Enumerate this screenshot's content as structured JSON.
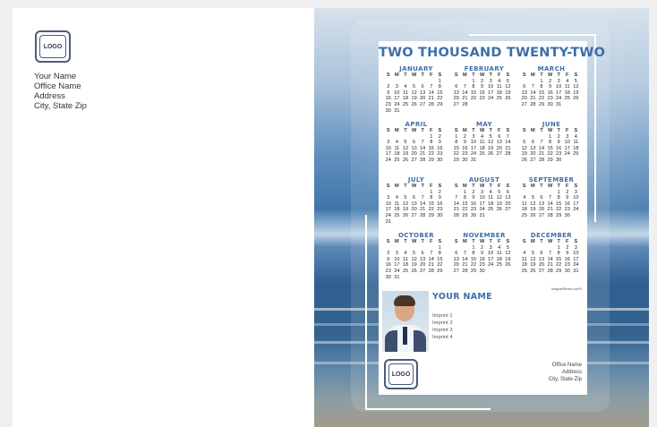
{
  "sender": {
    "logo": "LOGO",
    "lines": [
      "Your Name",
      "Office Name",
      "Address",
      "City, State Zip"
    ]
  },
  "card": {
    "title": "TWO THOUSAND TWENTY-TWO",
    "dow": [
      "S",
      "M",
      "T",
      "W",
      "T",
      "F",
      "S"
    ],
    "months": [
      {
        "name": "JANUARY",
        "weeks": [
          [
            "",
            "",
            "",
            "",
            "",
            "",
            "1"
          ],
          [
            "2",
            "3",
            "4",
            "5",
            "6",
            "7",
            "8"
          ],
          [
            "9",
            "10",
            "11",
            "12",
            "13",
            "14",
            "15"
          ],
          [
            "16",
            "17",
            "18",
            "19",
            "20",
            "21",
            "22"
          ],
          [
            "23",
            "24",
            "25",
            "26",
            "27",
            "28",
            "29"
          ],
          [
            "30",
            "31",
            "",
            "",
            "",
            "",
            ""
          ]
        ]
      },
      {
        "name": "FEBRUARY",
        "weeks": [
          [
            "",
            "",
            "1",
            "2",
            "3",
            "4",
            "5"
          ],
          [
            "6",
            "7",
            "8",
            "9",
            "10",
            "11",
            "12"
          ],
          [
            "13",
            "14",
            "15",
            "16",
            "17",
            "18",
            "19"
          ],
          [
            "20",
            "21",
            "22",
            "23",
            "24",
            "25",
            "26"
          ],
          [
            "27",
            "28",
            "",
            "",
            "",
            "",
            ""
          ]
        ]
      },
      {
        "name": "MARCH",
        "weeks": [
          [
            "",
            "",
            "1",
            "2",
            "3",
            "4",
            "5"
          ],
          [
            "6",
            "7",
            "8",
            "9",
            "10",
            "11",
            "12"
          ],
          [
            "13",
            "14",
            "15",
            "16",
            "17",
            "18",
            "19"
          ],
          [
            "20",
            "21",
            "22",
            "23",
            "24",
            "25",
            "26"
          ],
          [
            "27",
            "28",
            "29",
            "30",
            "31",
            "",
            ""
          ]
        ]
      },
      {
        "name": "APRIL",
        "weeks": [
          [
            "",
            "",
            "",
            "",
            "",
            "1",
            "2"
          ],
          [
            "3",
            "4",
            "5",
            "6",
            "7",
            "8",
            "9"
          ],
          [
            "10",
            "11",
            "12",
            "13",
            "14",
            "15",
            "16"
          ],
          [
            "17",
            "18",
            "19",
            "20",
            "21",
            "22",
            "23"
          ],
          [
            "24",
            "25",
            "26",
            "27",
            "28",
            "29",
            "30"
          ]
        ]
      },
      {
        "name": "MAY",
        "weeks": [
          [
            "1",
            "2",
            "3",
            "4",
            "5",
            "6",
            "7"
          ],
          [
            "8",
            "9",
            "10",
            "11",
            "12",
            "13",
            "14"
          ],
          [
            "15",
            "16",
            "17",
            "18",
            "19",
            "20",
            "21"
          ],
          [
            "22",
            "23",
            "24",
            "25",
            "26",
            "27",
            "28"
          ],
          [
            "29",
            "30",
            "31",
            "",
            "",
            "",
            ""
          ]
        ]
      },
      {
        "name": "JUNE",
        "weeks": [
          [
            "",
            "",
            "",
            "1",
            "2",
            "3",
            "4"
          ],
          [
            "5",
            "6",
            "7",
            "8",
            "9",
            "10",
            "11"
          ],
          [
            "12",
            "13",
            "14",
            "15",
            "16",
            "17",
            "18"
          ],
          [
            "19",
            "20",
            "21",
            "22",
            "23",
            "24",
            "25"
          ],
          [
            "26",
            "27",
            "28",
            "29",
            "30",
            "",
            ""
          ]
        ]
      },
      {
        "name": "JULY",
        "weeks": [
          [
            "",
            "",
            "",
            "",
            "",
            "1",
            "2"
          ],
          [
            "3",
            "4",
            "5",
            "6",
            "7",
            "8",
            "9"
          ],
          [
            "10",
            "11",
            "12",
            "13",
            "14",
            "15",
            "16"
          ],
          [
            "17",
            "18",
            "19",
            "20",
            "21",
            "22",
            "23"
          ],
          [
            "24",
            "25",
            "26",
            "27",
            "28",
            "29",
            "30"
          ],
          [
            "31",
            "",
            "",
            "",
            "",
            "",
            ""
          ]
        ]
      },
      {
        "name": "AUGUST",
        "weeks": [
          [
            "",
            "1",
            "2",
            "3",
            "4",
            "5",
            "6"
          ],
          [
            "7",
            "8",
            "9",
            "10",
            "11",
            "12",
            "13"
          ],
          [
            "14",
            "15",
            "16",
            "17",
            "18",
            "19",
            "20"
          ],
          [
            "21",
            "22",
            "23",
            "24",
            "25",
            "26",
            "27"
          ],
          [
            "28",
            "29",
            "30",
            "31",
            "",
            "",
            ""
          ]
        ]
      },
      {
        "name": "SEPTEMBER",
        "weeks": [
          [
            "",
            "",
            "",
            "",
            "1",
            "2",
            "3"
          ],
          [
            "4",
            "5",
            "6",
            "7",
            "8",
            "9",
            "10"
          ],
          [
            "11",
            "12",
            "13",
            "14",
            "15",
            "16",
            "17"
          ],
          [
            "18",
            "19",
            "20",
            "21",
            "22",
            "23",
            "24"
          ],
          [
            "25",
            "26",
            "27",
            "28",
            "29",
            "30",
            ""
          ]
        ]
      },
      {
        "name": "OCTOBER",
        "weeks": [
          [
            "",
            "",
            "",
            "",
            "",
            "",
            "1"
          ],
          [
            "2",
            "3",
            "4",
            "5",
            "6",
            "7",
            "8"
          ],
          [
            "9",
            "10",
            "11",
            "12",
            "13",
            "14",
            "15"
          ],
          [
            "16",
            "17",
            "18",
            "19",
            "20",
            "21",
            "22"
          ],
          [
            "23",
            "24",
            "25",
            "26",
            "27",
            "28",
            "29"
          ],
          [
            "30",
            "31",
            "",
            "",
            "",
            "",
            ""
          ]
        ]
      },
      {
        "name": "NOVEMBER",
        "weeks": [
          [
            "",
            "",
            "1",
            "2",
            "3",
            "4",
            "5"
          ],
          [
            "6",
            "7",
            "8",
            "9",
            "10",
            "11",
            "12"
          ],
          [
            "13",
            "14",
            "15",
            "16",
            "17",
            "18",
            "19"
          ],
          [
            "20",
            "21",
            "22",
            "23",
            "24",
            "25",
            "26"
          ],
          [
            "27",
            "28",
            "29",
            "30",
            "",
            "",
            ""
          ]
        ]
      },
      {
        "name": "DECEMBER",
        "weeks": [
          [
            "",
            "",
            "",
            "",
            "1",
            "2",
            "3"
          ],
          [
            "4",
            "5",
            "6",
            "7",
            "8",
            "9",
            "10"
          ],
          [
            "11",
            "12",
            "13",
            "14",
            "15",
            "16",
            "17"
          ],
          [
            "18",
            "19",
            "20",
            "21",
            "22",
            "23",
            "24"
          ],
          [
            "25",
            "26",
            "27",
            "28",
            "29",
            "30",
            "31"
          ]
        ]
      }
    ],
    "attribution": "MagnetStreet.com®",
    "your_name": "YOUR NAME",
    "imprints": [
      "Imprint 1",
      "Imprint 2",
      "Imprint 3",
      "Imprint 4"
    ],
    "logo": "LOGO",
    "office": [
      "Office Name",
      "Address",
      "City, State Zip"
    ]
  },
  "colors": {
    "accent": "#3e6ea8",
    "logo_border": "#4d5b7a"
  },
  "icons": {
    "photo": "headshot-photo",
    "logo": "logo-placeholder-icon"
  }
}
